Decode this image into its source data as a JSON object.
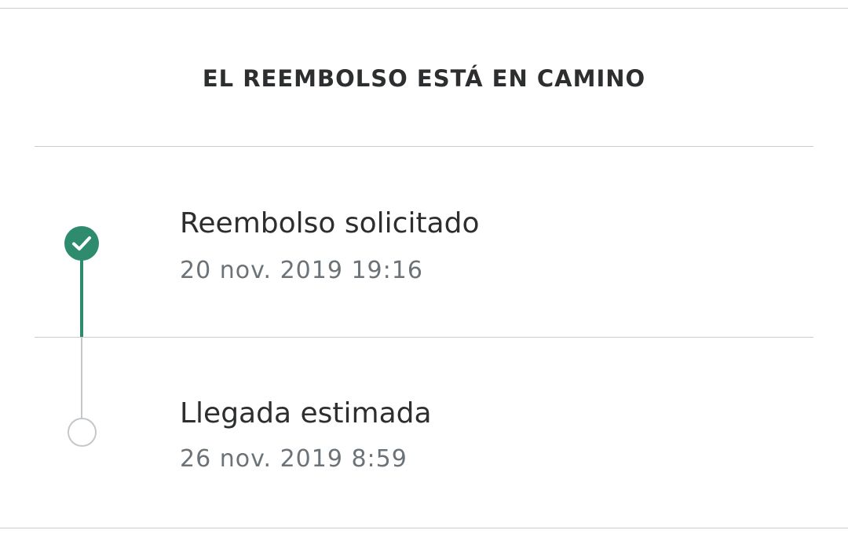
{
  "header": {
    "title": "EL REEMBOLSO ESTÁ EN CAMINO"
  },
  "steps": [
    {
      "title": "Reembolso solicitado",
      "date": "20 nov. 2019 19:16",
      "status": "completed",
      "icon": "check-circle-icon"
    },
    {
      "title": "Llegada estimada",
      "date": "26 nov. 2019 8:59",
      "status": "pending",
      "icon": "empty-circle-icon"
    }
  ],
  "colors": {
    "accent": "#2e8b6e",
    "pending": "#c2c8cc",
    "text": "#2c2e2f",
    "secondary_text": "#6c7378",
    "divider": "#c9cccf"
  }
}
